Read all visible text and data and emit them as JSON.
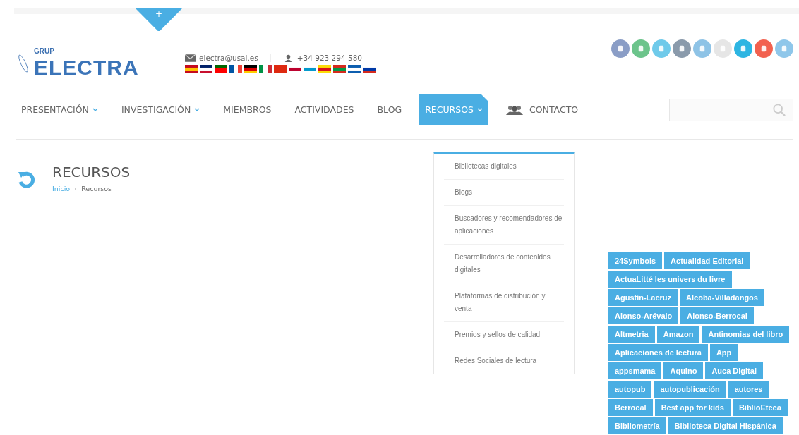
{
  "top_tab": {
    "label": "+"
  },
  "logo": {
    "small": "GRUP",
    "main": "ELECTRA"
  },
  "contact": {
    "email": "electra@usal.es",
    "phone": "+34 923 294 580"
  },
  "nav": [
    {
      "label": "PRESENTACIÓN",
      "dropdown": true,
      "selected": false,
      "kind": "text"
    },
    {
      "label": "INVESTIGACIÓN",
      "dropdown": true,
      "selected": false,
      "kind": "text"
    },
    {
      "label": "MIEMBROS",
      "dropdown": false,
      "selected": false,
      "kind": "text"
    },
    {
      "label": "ACTIVIDADES",
      "dropdown": false,
      "selected": false,
      "kind": "text"
    },
    {
      "label": "BLOG",
      "dropdown": false,
      "selected": false,
      "kind": "text"
    },
    {
      "label": "RECURSOS",
      "dropdown": true,
      "selected": true,
      "kind": "text"
    },
    {
      "label": "CONTACTO",
      "dropdown": false,
      "selected": false,
      "kind": "people"
    }
  ],
  "dropdown_menu": [
    "Bibliotecas digitales",
    "Blogs",
    "Buscadores y recomendadores de aplicaciones",
    "Desarrolladores de contenidos digitales",
    "Plataformas de distribución y venta",
    "Premios y sellos de calidad",
    "Redes Sociales de lectura"
  ],
  "page_title": "RECURSOS",
  "breadcrumb": [
    {
      "label": "Inicio",
      "link": true
    },
    {
      "label": "Recursos",
      "link": false
    }
  ],
  "tags": [
    [
      "24Symbols",
      "Actualidad Editorial"
    ],
    [
      "ActuaLitté les univers du livre"
    ],
    [
      "Agustín-Lacruz",
      "Alcoba-Villadangos"
    ],
    [
      "Alonso-Arévalo",
      "Alonso-Berrocal"
    ],
    [
      "Altmetria",
      "Amazon",
      "Antinomias del libro"
    ],
    [
      "Aplicaciones de lectura",
      "App"
    ],
    [
      "appsmama",
      "Aquino",
      "Auca Digital"
    ],
    [
      "autopub",
      "autopublicación",
      "autores"
    ],
    [
      "Berrocal",
      "Best app for kids",
      "BiblioEteca"
    ],
    [
      "Bibliometría",
      "Biblioteca Digital Hispánica"
    ]
  ]
}
